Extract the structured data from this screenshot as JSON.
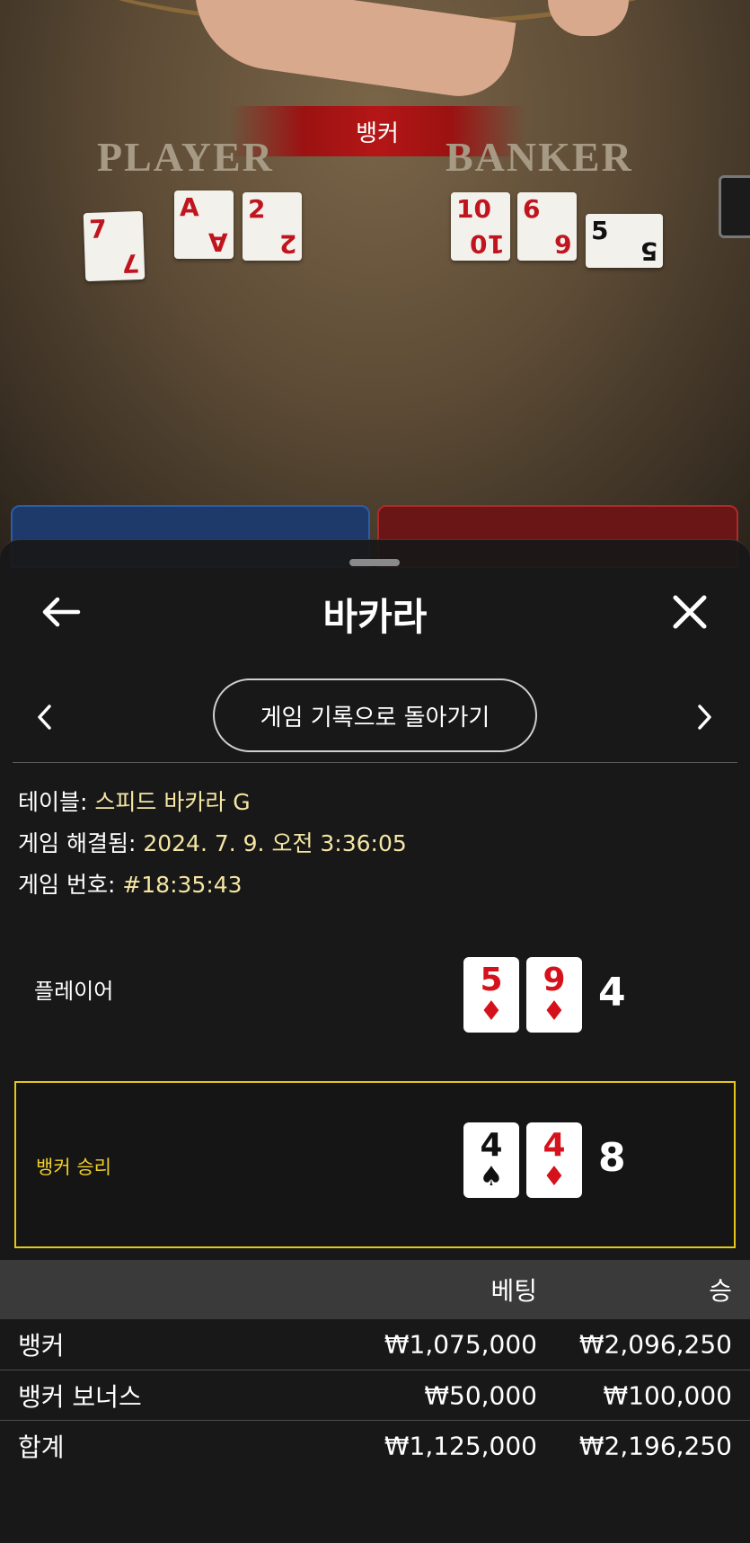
{
  "video": {
    "result_banner": "뱅커",
    "player_label": "PLAYER",
    "banker_label": "BANKER",
    "player_cards": [
      {
        "rank": "7",
        "suit": "♥",
        "color": "red"
      },
      {
        "rank": "A",
        "suit": "♦",
        "color": "red"
      },
      {
        "rank": "2",
        "suit": "♥",
        "color": "red"
      }
    ],
    "banker_cards": [
      {
        "rank": "10",
        "suit": "♥",
        "color": "red"
      },
      {
        "rank": "6",
        "suit": "♥",
        "color": "red"
      },
      {
        "rank": "5",
        "suit": "♠",
        "color": "black"
      }
    ]
  },
  "sheet": {
    "title": "바카라",
    "history_button": "게임 기록으로 돌아가기",
    "info": {
      "table_label": "테이블: ",
      "table_value": "스피드 바카라 G",
      "resolved_label": "게임 해결됨: ",
      "resolved_value": "2024. 7. 9. 오전 3:36:05",
      "game_no_label": "게임 번호: ",
      "game_no_value": "#18:35:43"
    },
    "player_hand": {
      "label": "플레이어",
      "cards": [
        {
          "rank": "5",
          "suit": "♦",
          "color": "red"
        },
        {
          "rank": "9",
          "suit": "♦",
          "color": "red"
        }
      ],
      "score": "4"
    },
    "banker_hand": {
      "label": "뱅커 승리",
      "cards": [
        {
          "rank": "4",
          "suit": "♠",
          "color": "black"
        },
        {
          "rank": "4",
          "suit": "♦",
          "color": "red"
        }
      ],
      "score": "8"
    },
    "bets": {
      "header_bet": "베팅",
      "header_win": "승",
      "rows": [
        {
          "name": "뱅커",
          "bet": "₩1,075,000",
          "win": "₩2,096,250"
        },
        {
          "name": "뱅커 보너스",
          "bet": "₩50,000",
          "win": "₩100,000"
        },
        {
          "name": "합계",
          "bet": "₩1,125,000",
          "win": "₩2,196,250"
        }
      ]
    }
  },
  "colors": {
    "winner_border": "#e6c61b",
    "info_value": "#f5e6a3",
    "red_suit": "#d5121c"
  }
}
